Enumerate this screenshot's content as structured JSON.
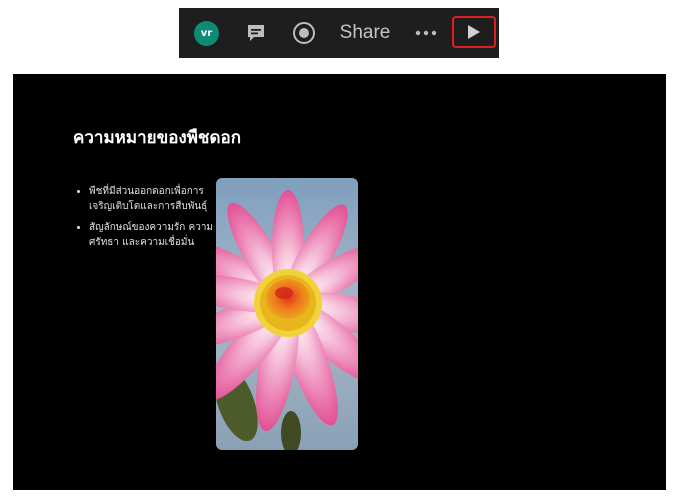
{
  "toolbar": {
    "avatar": {
      "initials": "vr",
      "color": "#0f8a74"
    },
    "icons": {
      "comment": "comment-icon",
      "record": "record-icon",
      "more": "more-horizontal-icon",
      "present": "play-icon"
    },
    "share_label": "Share",
    "highlight_color": "#e02020"
  },
  "slide": {
    "title": "ความหมายของพืชดอก",
    "bullets": [
      "พืชที่มีส่วนออกดอกเพื่อการเจริญเติบโตและการสืบพันธุ์",
      "สัญลักษณ์ของความรัก ความศรัทธา และความเชื่อมั่น"
    ],
    "image": "pink-flower-photo",
    "background": "#000000"
  }
}
